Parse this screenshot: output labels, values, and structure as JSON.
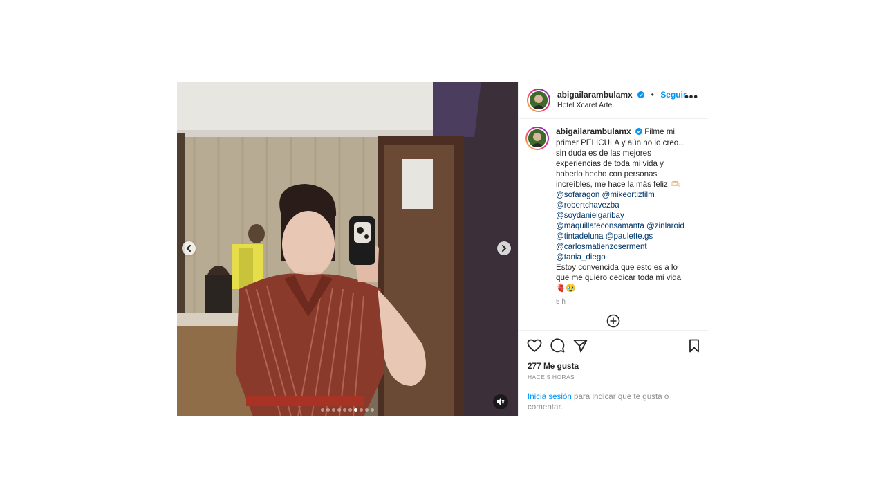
{
  "post": {
    "username": "abigailarambulamx",
    "follow_label": "Seguir",
    "separator": "•",
    "location": "Hotel Xcaret Arte",
    "more_label": "•••",
    "caption_lines": [
      "Filme mi",
      "primer PELICULA y aún no lo creo...",
      "sin duda es de las mejores",
      "experiencias de toda mi vida y",
      "haberlo hecho con personas",
      "increíbles, me hace la más feliz 🫶🏻"
    ],
    "mentions": [
      "@sofaragon @mikeortizfilm",
      "@robertchavezba",
      "@soydanielgaribay",
      "@maquillateconsamanta @zinlaroid",
      "@tintadeluna @paulette.gs",
      "@carlosmatienzoserment",
      "@tania_diego"
    ],
    "caption_end": [
      "Estoy convencida que esto es a lo",
      "que me quiero dedicar toda mi vida",
      "🫀🥹"
    ],
    "time_ago": "5 h",
    "likes": "277 Me gusta",
    "posted": "HACE 5 HORAS",
    "login_link": "Inicia sesión",
    "login_text": " para indicar que te gusta o comentar."
  },
  "carousel": {
    "total": 10,
    "active_index": 6
  },
  "icons": {
    "prev": "chevron-left-icon",
    "next": "chevron-right-icon",
    "mute": "speaker-muted-icon",
    "verified": "verified-badge-icon",
    "add": "add-comment-icon",
    "like": "heart-icon",
    "comment": "comment-icon",
    "share": "paper-plane-icon",
    "save": "bookmark-icon"
  },
  "colors": {
    "link": "#0095f6",
    "mention": "#00376b",
    "muted": "#8e8e8e"
  }
}
